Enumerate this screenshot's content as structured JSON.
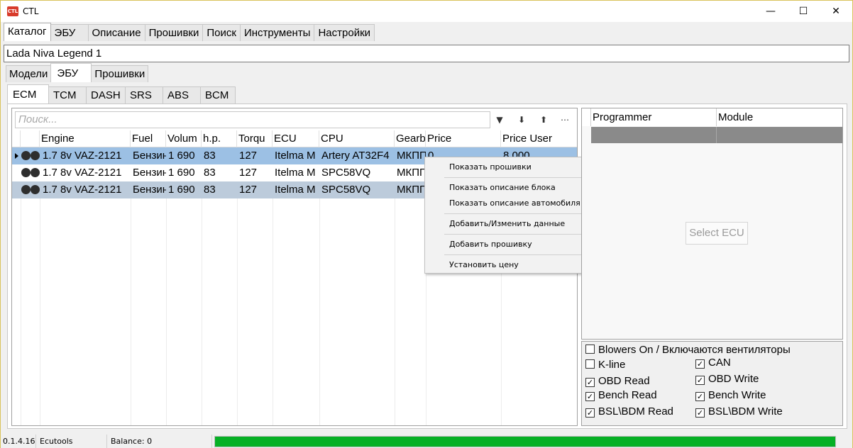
{
  "window": {
    "title": "CTL",
    "logo_text": "CTL",
    "minimize": "—",
    "maximize": "☐",
    "close": "✕"
  },
  "menu": [
    "Каталог",
    "ЭБУ",
    "Описание",
    "Прошивки",
    "Поиск",
    "Инструменты",
    "Настройки"
  ],
  "path": "Lada Niva Legend 1",
  "subtabs": [
    "Модели",
    "ЭБУ",
    "Прошивки"
  ],
  "ecu_tabs": [
    "ECM",
    "TCM",
    "DASH",
    "SRS",
    "ABS",
    "BCM"
  ],
  "search": {
    "placeholder": "Поиск..."
  },
  "toolbar_icons": [
    "filter-icon",
    "arrow-down-icon",
    "arrow-up-icon",
    "more-icon"
  ],
  "grid": {
    "columns": [
      "Engine",
      "Fuel",
      "Volum",
      "h.p.",
      "Torqu",
      "ECU",
      "CPU",
      "Gearb",
      "Price",
      "Price User"
    ],
    "rows": [
      {
        "engine": "1.7 8v VAZ-2121",
        "fuel": "Бензин",
        "volume": "1 690",
        "hp": "83",
        "torque": "127",
        "ecu": "Itelma M",
        "cpu": "Artery AT32F4",
        "gearbox": "МКПП",
        "price": "0",
        "price_user": "8 000"
      },
      {
        "engine": "1.7 8v VAZ-2121",
        "fuel": "Бензин",
        "volume": "1 690",
        "hp": "83",
        "torque": "127",
        "ecu": "Itelma M",
        "cpu": "SPC58VQ",
        "gearbox": "МКПП",
        "price": "",
        "price_user": ""
      },
      {
        "engine": "1.7 8v VAZ-2121",
        "fuel": "Бензин",
        "volume": "1 690",
        "hp": "83",
        "torque": "127",
        "ecu": "Itelma M",
        "cpu": "SPC58VQ",
        "gearbox": "МКПП",
        "price": "",
        "price_user": ""
      }
    ]
  },
  "context_menu": [
    "Показать прошивки",
    "Показать описание блока",
    "Показать описание автомобиля",
    "Добавить/Изменить данные",
    "Добавить прошивку",
    "Установить цену"
  ],
  "right_panel": {
    "columns": [
      "Programmer",
      "Module"
    ],
    "select_ecu": "Select ECU"
  },
  "options": {
    "blowers": {
      "label": "Blowers On / Включаются вентиляторы",
      "checked": false
    },
    "kline": {
      "label": "K-line",
      "checked": false
    },
    "can": {
      "label": "CAN",
      "checked": true
    },
    "obd_read": {
      "label": "OBD Read",
      "checked": true
    },
    "obd_write": {
      "label": "OBD Write",
      "checked": true
    },
    "bench_read": {
      "label": "Bench Read",
      "checked": true
    },
    "bench_write": {
      "label": "Bench Write",
      "checked": true
    },
    "bsl_read": {
      "label": "BSL\\BDM Read",
      "checked": true
    },
    "bsl_write": {
      "label": "BSL\\BDM Write",
      "checked": true
    },
    "check_mark": "✓"
  },
  "status": {
    "version": "0.1.4.16",
    "user": "Ecutools",
    "balance": "Balance: 0",
    "progress_percent": 100,
    "progress_color": "#06b025"
  }
}
